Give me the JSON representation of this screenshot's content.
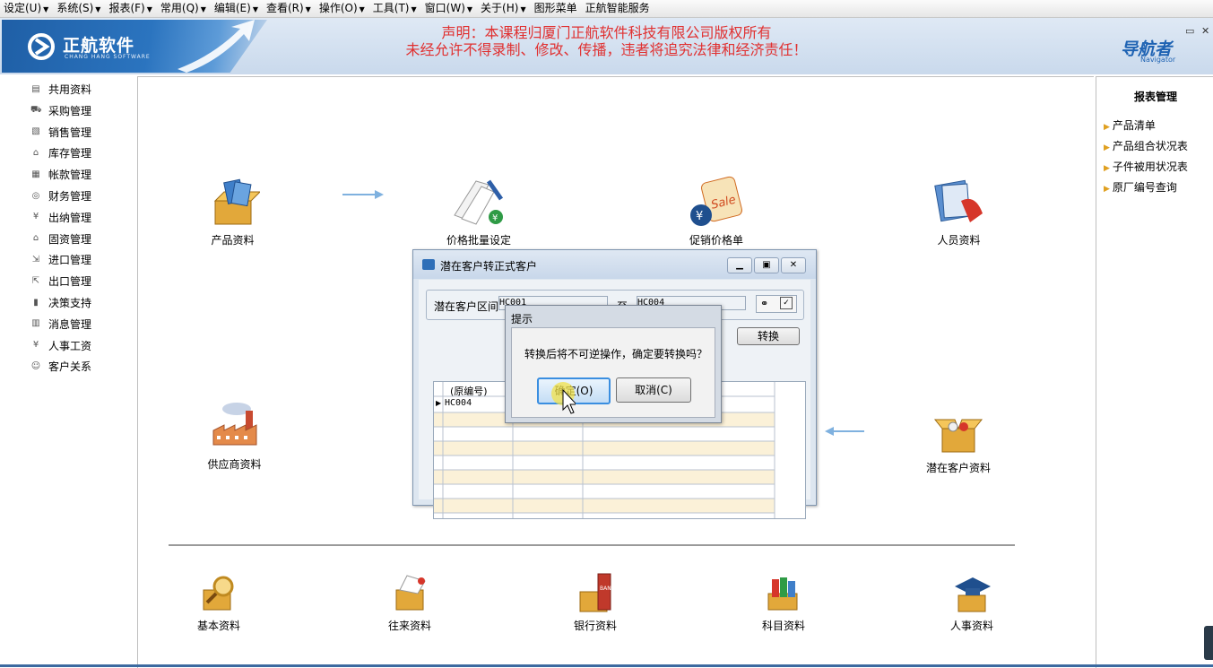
{
  "menubar": {
    "items": [
      {
        "label": "设定(U)",
        "arrow": "▼"
      },
      {
        "label": "系统(S)",
        "arrow": "▼"
      },
      {
        "label": "报表(F)",
        "arrow": "▼"
      },
      {
        "label": "常用(Q)",
        "arrow": "▼"
      },
      {
        "label": "编辑(E)",
        "arrow": "▼"
      },
      {
        "label": "查看(R)",
        "arrow": "▼"
      },
      {
        "label": "操作(O)",
        "arrow": "▼"
      },
      {
        "label": "工具(T)",
        "arrow": "▼"
      },
      {
        "label": "窗口(W)",
        "arrow": "▼"
      },
      {
        "label": "关于(H)",
        "arrow": "▼"
      },
      {
        "label": "图形菜单",
        "arrow": ""
      },
      {
        "label": "正航智能服务",
        "arrow": ""
      }
    ]
  },
  "banner": {
    "logo_text": "正航软件",
    "logo_sub": "CHANG HANG SOFTWARE",
    "notice_line1": "声明：本课程归厦门正航软件科技有限公司版权所有",
    "notice_line2": "未经允许不得录制、修改、传播，违者将追究法律和经济责任！",
    "navigator_text": "导航者",
    "navigator_sub": "Navigator",
    "restore_glyph": "▭",
    "close_glyph": "✕"
  },
  "sidebar": {
    "items": [
      {
        "label": "共用资料",
        "icon": "▤"
      },
      {
        "label": "采购管理",
        "icon": "⛟"
      },
      {
        "label": "销售管理",
        "icon": "▧"
      },
      {
        "label": "库存管理",
        "icon": "⌂"
      },
      {
        "label": "帐款管理",
        "icon": "▦"
      },
      {
        "label": "财务管理",
        "icon": "◎"
      },
      {
        "label": "出纳管理",
        "icon": "¥"
      },
      {
        "label": "固资管理",
        "icon": "⌂"
      },
      {
        "label": "进口管理",
        "icon": "⇲"
      },
      {
        "label": "出口管理",
        "icon": "⇱"
      },
      {
        "label": "决策支持",
        "icon": "▮"
      },
      {
        "label": "消息管理",
        "icon": "▥"
      },
      {
        "label": "人事工资",
        "icon": "¥"
      },
      {
        "label": "客户关系",
        "icon": "☺"
      }
    ]
  },
  "right_panel": {
    "title": "报表管理",
    "items": [
      "产品清单",
      "产品组合状况表",
      "子件被用状况表",
      "原厂编号查询"
    ]
  },
  "main": {
    "modules_top": [
      "产品资料",
      "价格批量设定",
      "促销价格单",
      "人员资料"
    ],
    "modules_mid": [
      "供应商资料",
      "潜在客户资料"
    ],
    "modules_bottom": [
      "基本资料",
      "往来资料",
      "银行资料",
      "科目资料",
      "人事资料"
    ]
  },
  "dialog": {
    "title": "潜在客户转正式客户",
    "range_label": "潜在客户区间",
    "range_from": "HC001",
    "range_to_label": "至",
    "range_to": "HC004",
    "convert_button": "转换",
    "grid_header": "(原编号)",
    "grid_rows": [
      "HC004"
    ]
  },
  "message_box": {
    "title": "提示",
    "text": "转换后将不可逆操作，确定要转换吗？",
    "ok_label": "确定(O)",
    "cancel_label": "取消(C)"
  },
  "colors": {
    "notice_red": "#e03030",
    "brand_blue": "#1f63b3",
    "grid_stripe": "#fbf1d8"
  }
}
